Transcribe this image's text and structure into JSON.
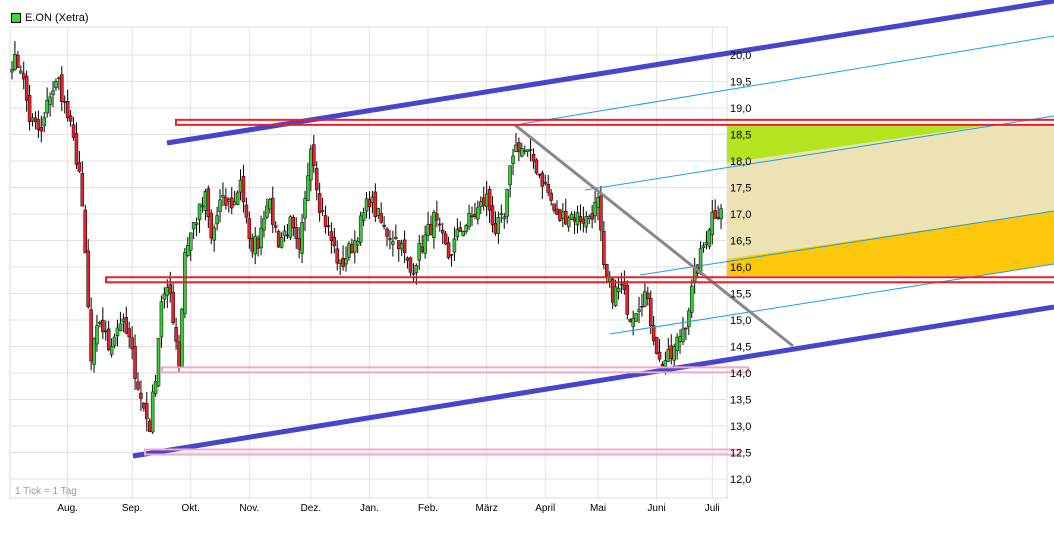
{
  "legend": {
    "label": "E.ON (Xetra)",
    "color": "#33dd33"
  },
  "tick_note": "1 Tick = 1 Tag",
  "chart_data": {
    "type": "candlestick",
    "title": "E.ON (Xetra)",
    "ylim": [
      11.75,
      20.5
    ],
    "yticks": [
      "12,0",
      "12,5",
      "13,0",
      "13,5",
      "14,0",
      "14,5",
      "15,0",
      "15,5",
      "16,0",
      "16,5",
      "17,0",
      "17,5",
      "18,0",
      "18,5",
      "19,0",
      "19,5",
      "20,0"
    ],
    "ytick_values": [
      12,
      12.5,
      13,
      13.5,
      14,
      14.5,
      15,
      15.5,
      16,
      16.5,
      17,
      17.5,
      18,
      18.5,
      19,
      19.5,
      20
    ],
    "months": [
      {
        "label": "Aug.",
        "day": 19
      },
      {
        "label": "Sep.",
        "day": 41
      },
      {
        "label": "Okt.",
        "day": 61
      },
      {
        "label": "Nov.",
        "day": 81
      },
      {
        "label": "Dez.",
        "day": 102
      },
      {
        "label": "Jan.",
        "day": 122
      },
      {
        "label": "Feb.",
        "day": 142
      },
      {
        "label": "März",
        "day": 162
      },
      {
        "label": "April",
        "day": 182
      },
      {
        "label": "Mai",
        "day": 200
      },
      {
        "label": "Juni",
        "day": 220
      },
      {
        "label": "Juli",
        "day": 239
      }
    ],
    "close_anchors_day_price": [
      [
        0,
        19.9
      ],
      [
        3,
        19.8
      ],
      [
        6,
        18.8
      ],
      [
        10,
        18.5
      ],
      [
        13,
        19.3
      ],
      [
        16,
        19.5
      ],
      [
        20,
        18.6
      ],
      [
        23,
        17.8
      ],
      [
        25,
        16.2
      ],
      [
        27,
        14.2
      ],
      [
        28,
        14.5
      ],
      [
        30,
        15.0
      ],
      [
        33,
        14.5
      ],
      [
        37,
        15.0
      ],
      [
        40,
        14.6
      ],
      [
        44,
        13.5
      ],
      [
        47,
        13.0
      ],
      [
        49,
        14.0
      ],
      [
        51,
        15.4
      ],
      [
        54,
        15.5
      ],
      [
        57,
        14.2
      ],
      [
        59,
        16.3
      ],
      [
        62,
        16.8
      ],
      [
        66,
        17.3
      ],
      [
        68,
        16.5
      ],
      [
        71,
        17.2
      ],
      [
        76,
        17.2
      ],
      [
        78,
        17.7
      ],
      [
        81,
        16.4
      ],
      [
        84,
        16.5
      ],
      [
        87,
        17.3
      ],
      [
        91,
        16.5
      ],
      [
        95,
        16.8
      ],
      [
        98,
        16.2
      ],
      [
        100,
        17.2
      ],
      [
        102,
        18.4
      ],
      [
        105,
        17.2
      ],
      [
        109,
        16.5
      ],
      [
        112,
        16.0
      ],
      [
        117,
        16.5
      ],
      [
        122,
        17.3
      ],
      [
        127,
        16.7
      ],
      [
        132,
        16.5
      ],
      [
        136,
        15.9
      ],
      [
        139,
        16.3
      ],
      [
        144,
        16.9
      ],
      [
        149,
        16.2
      ],
      [
        153,
        16.7
      ],
      [
        158,
        17.0
      ],
      [
        162,
        17.3
      ],
      [
        165,
        16.7
      ],
      [
        168,
        16.9
      ],
      [
        171,
        18.2
      ],
      [
        173,
        18.3
      ],
      [
        178,
        18.0
      ],
      [
        183,
        17.4
      ],
      [
        186,
        16.9
      ],
      [
        190,
        17.0
      ],
      [
        196,
        16.9
      ],
      [
        200,
        17.2
      ],
      [
        202,
        15.9
      ],
      [
        205,
        15.5
      ],
      [
        208,
        15.6
      ],
      [
        211,
        15.1
      ],
      [
        216,
        15.5
      ],
      [
        218,
        15.0
      ],
      [
        221,
        14.2
      ],
      [
        225,
        14.3
      ],
      [
        230,
        15.0
      ],
      [
        233,
        15.8
      ],
      [
        237,
        16.6
      ],
      [
        239,
        17.0
      ],
      [
        242,
        17.1
      ]
    ],
    "annotations": {
      "resistance_lines": [
        18.72,
        15.75
      ],
      "support_lines": [
        14.05,
        12.5
      ],
      "colors": {
        "trend": "#4646cc",
        "channel": "#1a9fe0",
        "resistance": "#e8202a",
        "support": "#f4a8c8",
        "downtrend": "#888888",
        "zone_green": "#b4e41e",
        "zone_beige": "#ede2b4",
        "zone_orange": "#fdc80c",
        "up": "#33cc33",
        "down": "#e8202a"
      }
    }
  }
}
